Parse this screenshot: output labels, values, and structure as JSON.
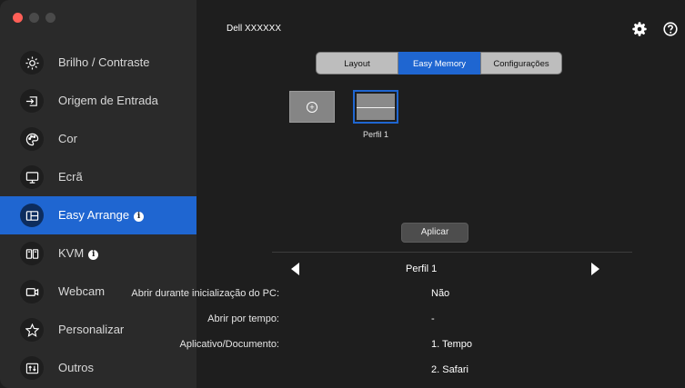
{
  "window": {
    "monitor_title": "Dell XXXXXX"
  },
  "sidebar": {
    "items": [
      {
        "label": "Brilho / Contraste",
        "icon": "sun-icon",
        "active": false
      },
      {
        "label": "Origem de Entrada",
        "icon": "input-source-icon",
        "active": false
      },
      {
        "label": "Cor",
        "icon": "palette-icon",
        "active": false
      },
      {
        "label": "Ecrã",
        "icon": "display-icon",
        "active": false
      },
      {
        "label": "Easy Arrange",
        "icon": "easy-arrange-icon",
        "active": true,
        "badge": "i"
      },
      {
        "label": "KVM",
        "icon": "kvm-icon",
        "active": false,
        "badge": "i"
      },
      {
        "label": "Webcam",
        "icon": "webcam-icon",
        "active": false
      },
      {
        "label": "Personalizar",
        "icon": "star-icon",
        "active": false
      },
      {
        "label": "Outros",
        "icon": "others-icon",
        "active": false
      }
    ]
  },
  "header": {
    "settings_icon": "gear-icon",
    "help_icon": "help-icon"
  },
  "tabs": [
    {
      "label": "Layout",
      "active": false
    },
    {
      "label": "Easy Memory",
      "active": true
    },
    {
      "label": "Configurações",
      "active": false
    }
  ],
  "profiles": {
    "add_icon": "add-icon",
    "items": [
      {
        "label": "Perfil 1",
        "selected": true
      }
    ]
  },
  "apply_label": "Aplicar",
  "details": {
    "profile_name": "Perfil 1",
    "open_on_startup_label": "Abrir durante inicialização do PC:",
    "open_on_startup_value": "Não",
    "open_by_time_label": "Abrir por tempo:",
    "open_by_time_value": "-",
    "apps_label": "Aplicativo/Documento:",
    "apps": [
      "1. Tempo",
      "2. Safari"
    ]
  },
  "colors": {
    "accent": "#1f66d1",
    "sidebar_bg": "#2a2a2a",
    "main_bg": "#1e1e1e"
  }
}
